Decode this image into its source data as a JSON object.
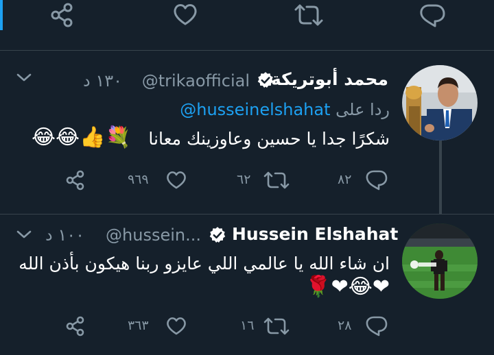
{
  "top_bar": {
    "icons": [
      "share-icon",
      "like-icon",
      "retweet-icon",
      "reply-icon"
    ]
  },
  "tweets": [
    {
      "name": "محمد أبوتريكة",
      "handle": "@trikaofficial",
      "time": "١٣٠ د",
      "reply_prefix": "ردا على",
      "reply_handle": "@husseinelshahat",
      "text": "شكرًا جدا يا حسين وعاوزينك معانا",
      "emojis": "😂😂👍💐",
      "likes": "٩٦٩",
      "retweets": "٦٢",
      "replies": "٨٢"
    },
    {
      "name": "Hussein Elshahat",
      "handle": "@hussein...",
      "time": "١٠٠ د",
      "text": "ان شاء الله يا عالمي اللي عايزو ربنا هيكون بأذن الله",
      "emojis": "❤😂❤🌹",
      "likes": "٣٦٣",
      "retweets": "١٦",
      "replies": "٢٨"
    }
  ],
  "colors": {
    "background": "#15202b",
    "muted": "#8899a6",
    "accent": "#1da1f2",
    "divider": "#38444d"
  }
}
